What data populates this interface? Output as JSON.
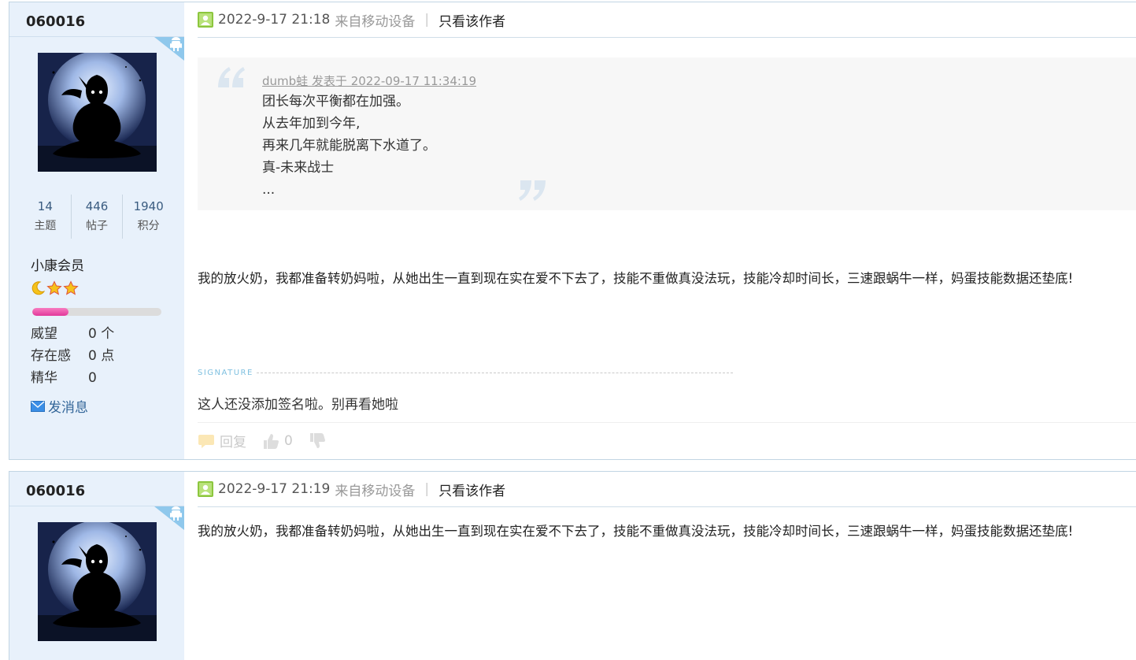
{
  "posts": [
    {
      "author": "060016",
      "stats": [
        {
          "num": "14",
          "label": "主题"
        },
        {
          "num": "446",
          "label": "帖子"
        },
        {
          "num": "1940",
          "label": "积分"
        }
      ],
      "usergroup": "小康会员",
      "level_progress": 0.28,
      "info": [
        {
          "key": "威望",
          "value": "0 个"
        },
        {
          "key": "存在感",
          "value": "0 点"
        },
        {
          "key": "精华",
          "value": "0"
        }
      ],
      "send_message": "发消息",
      "time": "2022-9-17 21:18",
      "source": "来自移动设备",
      "only_author": "只看该作者",
      "quote": {
        "author_line": "dumb蛙 发表于 2022-09-17 11:34:19",
        "lines": [
          "团长每次平衡都在加强。",
          "从去年加到今年,",
          "再来几年就能脱离下水道了。",
          "真-未来战士",
          "..."
        ]
      },
      "message": "我的放火奶，我都准备转奶妈啦，从她出生一直到现在实在爱不下去了，技能不重做真没法玩，技能冷却时间长，三速跟蜗牛一样，妈蛋技能数据还垫底!",
      "signature_label": "SIGNATURE",
      "signature": "这人还没添加签名啦。别再看她啦",
      "reply_label": "回复",
      "like_count": "0"
    },
    {
      "author": "060016",
      "time": "2022-9-17 21:19",
      "source": "来自移动设备",
      "only_author": "只看该作者",
      "message": "我的放火奶，我都准备转奶妈啦，从她出生一直到现在实在爱不下去了，技能不重做真没法玩，技能冷却时间长，三速跟蜗牛一样，妈蛋技能数据还垫底!"
    }
  ],
  "colors": {
    "sidebar_bg": "#e8f1fb",
    "link": "#336699",
    "progress": "#e2389a",
    "badge": "#8fc8ec"
  },
  "icons": {
    "mobile_badge": "android-icon",
    "post_head": "user-icon",
    "send_message": "envelope-icon",
    "reply": "chat-bubble-icon",
    "like": "thumbs-up-icon",
    "dislike": "thumbs-down-icon"
  }
}
